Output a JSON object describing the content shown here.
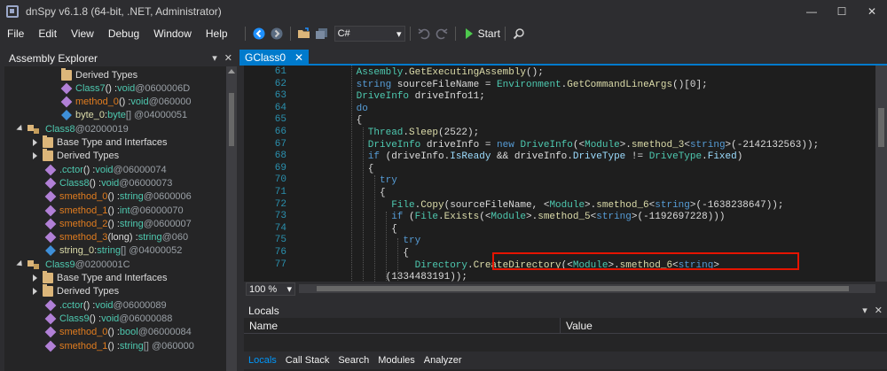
{
  "window": {
    "title": "dnSpy v6.1.8 (64-bit, .NET, Administrator)",
    "controls": [
      "—",
      "☐",
      "✕"
    ]
  },
  "menu": [
    "File",
    "Edit",
    "View",
    "Debug",
    "Window",
    "Help"
  ],
  "toolbar": {
    "language": "C#",
    "start_label": "Start"
  },
  "explorer": {
    "title": "Assembly Explorer",
    "rows": [
      {
        "indent": 110,
        "icon": "folder",
        "parts": [
          {
            "t": "Derived Types",
            "c": "c-gray"
          }
        ]
      },
      {
        "indent": 110,
        "icon": "method",
        "parts": [
          {
            "t": "Class7",
            "c": "c-class"
          },
          {
            "t": "() : ",
            "c": "c-gray"
          },
          {
            "t": "void",
            "c": "c-type"
          },
          {
            "t": " @0600006D",
            "c": "c-token"
          }
        ]
      },
      {
        "indent": 110,
        "icon": "method",
        "parts": [
          {
            "t": "method_0",
            "c": "c-method2"
          },
          {
            "t": "() : ",
            "c": "c-gray"
          },
          {
            "t": "void",
            "c": "c-type"
          },
          {
            "t": " @060000",
            "c": "c-token"
          }
        ]
      },
      {
        "indent": 110,
        "icon": "field",
        "parts": [
          {
            "t": "byte_0",
            "c": "c-field"
          },
          {
            "t": " : ",
            "c": "c-gray"
          },
          {
            "t": "byte",
            "c": "c-type"
          },
          {
            "t": "[] @04000051",
            "c": "c-token"
          }
        ]
      },
      {
        "indent": 60,
        "icon": "class",
        "expander": "expanded",
        "parts": [
          {
            "t": "Class8",
            "c": "c-class"
          },
          {
            "t": " @02000019",
            "c": "c-token"
          }
        ]
      },
      {
        "indent": 78,
        "icon": "folder",
        "expander": "collapsed",
        "parts": [
          {
            "t": "Base Type and Interfaces",
            "c": "c-gray"
          }
        ]
      },
      {
        "indent": 78,
        "icon": "folder",
        "expander": "collapsed",
        "parts": [
          {
            "t": "Derived Types",
            "c": "c-gray"
          }
        ]
      },
      {
        "indent": 92,
        "icon": "method",
        "parts": [
          {
            "t": ".cctor",
            "c": "c-ctor"
          },
          {
            "t": "() : ",
            "c": "c-gray"
          },
          {
            "t": "void",
            "c": "c-type"
          },
          {
            "t": " @06000074",
            "c": "c-token"
          }
        ]
      },
      {
        "indent": 92,
        "icon": "method",
        "parts": [
          {
            "t": "Class8",
            "c": "c-class"
          },
          {
            "t": "() : ",
            "c": "c-gray"
          },
          {
            "t": "void",
            "c": "c-type"
          },
          {
            "t": " @06000073",
            "c": "c-token"
          }
        ]
      },
      {
        "indent": 92,
        "icon": "method",
        "parts": [
          {
            "t": "smethod_0",
            "c": "c-method2"
          },
          {
            "t": "() : ",
            "c": "c-gray"
          },
          {
            "t": "string",
            "c": "c-type"
          },
          {
            "t": " @0600006",
            "c": "c-token"
          }
        ]
      },
      {
        "indent": 92,
        "icon": "method",
        "parts": [
          {
            "t": "smethod_1",
            "c": "c-method2"
          },
          {
            "t": "() : ",
            "c": "c-gray"
          },
          {
            "t": "int",
            "c": "c-type"
          },
          {
            "t": " @06000070",
            "c": "c-token"
          }
        ]
      },
      {
        "indent": 92,
        "icon": "method",
        "parts": [
          {
            "t": "smethod_2",
            "c": "c-method2"
          },
          {
            "t": "() : ",
            "c": "c-gray"
          },
          {
            "t": "string",
            "c": "c-type"
          },
          {
            "t": " @0600007",
            "c": "c-token"
          }
        ]
      },
      {
        "indent": 92,
        "icon": "method",
        "parts": [
          {
            "t": "smethod_3",
            "c": "c-method2"
          },
          {
            "t": "(long) : ",
            "c": "c-gray"
          },
          {
            "t": "string",
            "c": "c-type"
          },
          {
            "t": " @060",
            "c": "c-token"
          }
        ]
      },
      {
        "indent": 92,
        "icon": "field",
        "parts": [
          {
            "t": "string_0",
            "c": "c-field"
          },
          {
            "t": " : ",
            "c": "c-gray"
          },
          {
            "t": "string",
            "c": "c-type"
          },
          {
            "t": "[] @04000052",
            "c": "c-token"
          }
        ]
      },
      {
        "indent": 60,
        "icon": "class",
        "expander": "expanded",
        "parts": [
          {
            "t": "Class9",
            "c": "c-class"
          },
          {
            "t": " @0200001C",
            "c": "c-token"
          }
        ]
      },
      {
        "indent": 78,
        "icon": "folder",
        "expander": "collapsed",
        "parts": [
          {
            "t": "Base Type and Interfaces",
            "c": "c-gray"
          }
        ]
      },
      {
        "indent": 78,
        "icon": "folder",
        "expander": "collapsed",
        "parts": [
          {
            "t": "Derived Types",
            "c": "c-gray"
          }
        ]
      },
      {
        "indent": 92,
        "icon": "method",
        "parts": [
          {
            "t": ".cctor",
            "c": "c-ctor"
          },
          {
            "t": "() : ",
            "c": "c-gray"
          },
          {
            "t": "void",
            "c": "c-type"
          },
          {
            "t": " @06000089",
            "c": "c-token"
          }
        ]
      },
      {
        "indent": 92,
        "icon": "method",
        "parts": [
          {
            "t": "Class9",
            "c": "c-class"
          },
          {
            "t": "() : ",
            "c": "c-gray"
          },
          {
            "t": "void",
            "c": "c-type"
          },
          {
            "t": " @06000088",
            "c": "c-token"
          }
        ]
      },
      {
        "indent": 92,
        "icon": "method",
        "parts": [
          {
            "t": "smethod_0",
            "c": "c-method2"
          },
          {
            "t": "() : ",
            "c": "c-gray"
          },
          {
            "t": "bool",
            "c": "c-type"
          },
          {
            "t": " @06000084",
            "c": "c-token"
          }
        ]
      },
      {
        "indent": 92,
        "icon": "method",
        "parts": [
          {
            "t": "smethod_1",
            "c": "c-method2"
          },
          {
            "t": "() : ",
            "c": "c-gray"
          },
          {
            "t": "string",
            "c": "c-type"
          },
          {
            "t": "[] @060000",
            "c": "c-token"
          }
        ]
      }
    ]
  },
  "editor": {
    "tab_label": "GClass0",
    "zoom": "100 %",
    "lines": [
      {
        "n": "61",
        "indent": 11,
        "parts": [
          {
            "t": "Assembly",
            "c": "t"
          },
          {
            "t": "."
          },
          {
            "t": "GetExecutingAssembly",
            "c": "m"
          },
          {
            "t": "();"
          }
        ]
      },
      {
        "n": "62",
        "indent": 11,
        "parts": [
          {
            "t": "string",
            "c": "k"
          },
          {
            "t": " sourceFileName = "
          },
          {
            "t": "Environment",
            "c": "t"
          },
          {
            "t": "."
          },
          {
            "t": "GetCommandLineArgs",
            "c": "m"
          },
          {
            "t": "()[0];"
          }
        ]
      },
      {
        "n": "63",
        "indent": 11,
        "parts": [
          {
            "t": "DriveInfo",
            "c": "t"
          },
          {
            "t": " driveInfo11;"
          }
        ]
      },
      {
        "n": "64",
        "indent": 11,
        "parts": [
          {
            "t": "do",
            "c": "k"
          }
        ]
      },
      {
        "n": "65",
        "indent": 11,
        "parts": [
          {
            "t": "{"
          }
        ]
      },
      {
        "n": "66",
        "indent": 13,
        "parts": [
          {
            "t": "Thread",
            "c": "t"
          },
          {
            "t": "."
          },
          {
            "t": "Sleep",
            "c": "m"
          },
          {
            "t": "(2522);"
          }
        ]
      },
      {
        "n": "67",
        "indent": 13,
        "parts": [
          {
            "t": "DriveInfo",
            "c": "t"
          },
          {
            "t": " driveInfo = "
          },
          {
            "t": "new",
            "c": "k"
          },
          {
            "t": " "
          },
          {
            "t": "DriveInfo",
            "c": "t"
          },
          {
            "t": "(<"
          },
          {
            "t": "Module",
            "c": "t"
          },
          {
            "t": ">."
          },
          {
            "t": "smethod_3",
            "c": "m"
          },
          {
            "t": "<"
          },
          {
            "t": "string",
            "c": "k"
          },
          {
            "t": ">(-2142132563));"
          }
        ]
      },
      {
        "n": "68",
        "indent": 13,
        "parts": [
          {
            "t": "if",
            "c": "k"
          },
          {
            "t": " (driveInfo."
          },
          {
            "t": "IsReady",
            "c": "p"
          },
          {
            "t": " && driveInfo."
          },
          {
            "t": "DriveType",
            "c": "p"
          },
          {
            "t": " != "
          },
          {
            "t": "DriveType",
            "c": "t"
          },
          {
            "t": "."
          },
          {
            "t": "Fixed",
            "c": "p"
          },
          {
            "t": ")"
          }
        ]
      },
      {
        "n": "69",
        "indent": 13,
        "parts": [
          {
            "t": "{"
          }
        ]
      },
      {
        "n": "70",
        "indent": 15,
        "parts": [
          {
            "t": "try",
            "c": "k"
          }
        ]
      },
      {
        "n": "71",
        "indent": 15,
        "parts": [
          {
            "t": "{"
          }
        ]
      },
      {
        "n": "72",
        "indent": 17,
        "parts": [
          {
            "t": "File",
            "c": "t"
          },
          {
            "t": "."
          },
          {
            "t": "Copy",
            "c": "m"
          },
          {
            "t": "(sourceFileName, <"
          },
          {
            "t": "Module",
            "c": "t"
          },
          {
            "t": ">."
          },
          {
            "t": "smethod_6",
            "c": "m"
          },
          {
            "t": "<"
          },
          {
            "t": "string",
            "c": "k"
          },
          {
            "t": ">(-1638238647));"
          }
        ]
      },
      {
        "n": "73",
        "indent": 17,
        "parts": [
          {
            "t": "if",
            "c": "k"
          },
          {
            "t": " ("
          },
          {
            "t": "File",
            "c": "t"
          },
          {
            "t": "."
          },
          {
            "t": "Exists",
            "c": "m"
          },
          {
            "t": "(<"
          },
          {
            "t": "Module",
            "c": "t"
          },
          {
            "t": ">."
          },
          {
            "t": "smethod_5",
            "c": "m"
          },
          {
            "t": "<"
          },
          {
            "t": "string",
            "c": "k"
          },
          {
            "t": ">(-1192697228)))"
          }
        ]
      },
      {
        "n": "74",
        "indent": 17,
        "parts": [
          {
            "t": "{"
          }
        ]
      },
      {
        "n": "75",
        "indent": 19,
        "parts": [
          {
            "t": "try",
            "c": "k"
          }
        ]
      },
      {
        "n": "76",
        "indent": 19,
        "parts": [
          {
            "t": "{"
          }
        ]
      },
      {
        "n": "77",
        "indent": 21,
        "parts": [
          {
            "t": "Directory",
            "c": "t"
          },
          {
            "t": "."
          },
          {
            "t": "CreateDirectory",
            "c": "m"
          },
          {
            "t": "(<"
          },
          {
            "t": "Module",
            "c": "t"
          },
          {
            "t": ">."
          },
          {
            "t": "smethod_6",
            "c": "m"
          },
          {
            "t": "<"
          },
          {
            "t": "string",
            "c": "k"
          },
          {
            "t": ">"
          }
        ]
      },
      {
        "n": "",
        "indent": 16,
        "parts": [
          {
            "t": "(1334483191));"
          }
        ]
      }
    ]
  },
  "locals": {
    "title": "Locals",
    "columns": [
      "Name",
      "Value"
    ]
  },
  "bottom_tabs": [
    "Locals",
    "Call Stack",
    "Search",
    "Modules",
    "Analyzer"
  ]
}
